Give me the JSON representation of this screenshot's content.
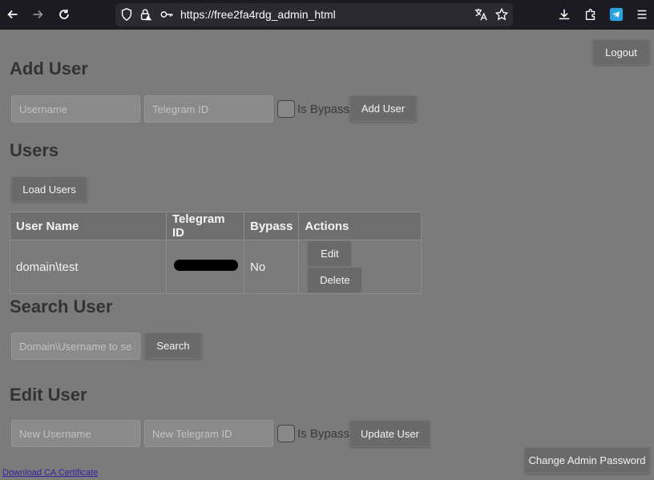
{
  "browser": {
    "url": "https://free2fa4rdg_admin_html"
  },
  "header": {
    "logout_label": "Logout"
  },
  "add_user": {
    "title": "Add User",
    "username_placeholder": "Username",
    "telegram_placeholder": "Telegram ID",
    "bypass_label": "Is Bypass",
    "submit_label": "Add User"
  },
  "users": {
    "title": "Users",
    "load_label": "Load Users",
    "columns": [
      "User Name",
      "Telegram ID",
      "Bypass",
      "Actions"
    ],
    "rows": [
      {
        "username": "domain\\test",
        "bypass": "No",
        "edit_label": "Edit",
        "delete_label": "Delete"
      }
    ]
  },
  "search": {
    "title": "Search User",
    "input_placeholder": "Domain\\Username to search",
    "button_label": "Search"
  },
  "edit_user": {
    "title": "Edit User",
    "username_placeholder": "New Username",
    "telegram_placeholder": "New Telegram ID",
    "bypass_label": "Is Bypass",
    "submit_label": "Update User"
  },
  "footer": {
    "download_link": "Download CA Certificate",
    "change_password_label": "Change Admin Password"
  }
}
